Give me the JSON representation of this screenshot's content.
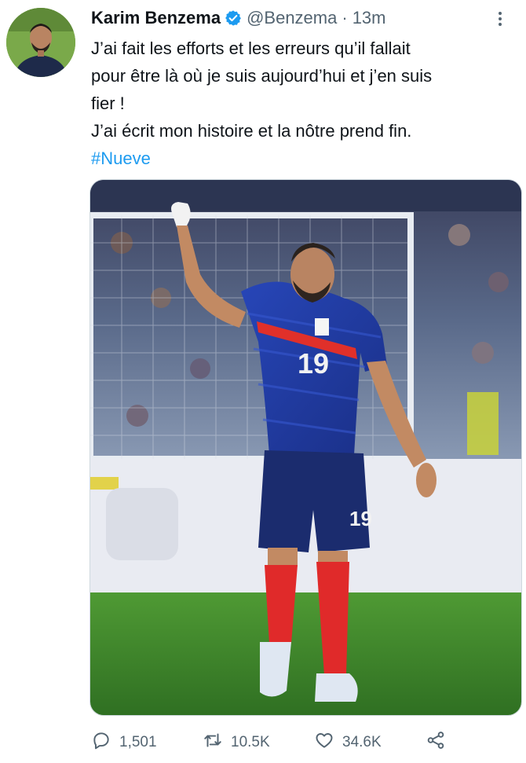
{
  "tweet": {
    "author_name": "Karim Benzema",
    "handle": "@Benzema",
    "separator": "·",
    "time": "13m",
    "text_lines": [
      "J’ai fait les efforts et les erreurs qu’il fallait",
      "pour être là où je suis aujourd’hui et j’en suis",
      "fier !",
      "J’ai écrit mon histoire et la nôtre prend fin."
    ],
    "hashtag": "#Nueve",
    "media": {
      "description_icon": "photo",
      "jersey_number": "19",
      "shorts_number": "19"
    },
    "actions": {
      "replies": "1,501",
      "retweets": "10.5K",
      "likes": "34.6K"
    }
  },
  "colors": {
    "accent": "#1d9bf0",
    "text": "#0f1419",
    "secondary": "#536471",
    "jersey": "#1e3a9c",
    "socks": "#e02a2a",
    "pitch": "#3f8a2c"
  },
  "icons": [
    "verified-badge-icon",
    "more-icon",
    "reply-icon",
    "retweet-icon",
    "like-icon",
    "share-icon"
  ]
}
